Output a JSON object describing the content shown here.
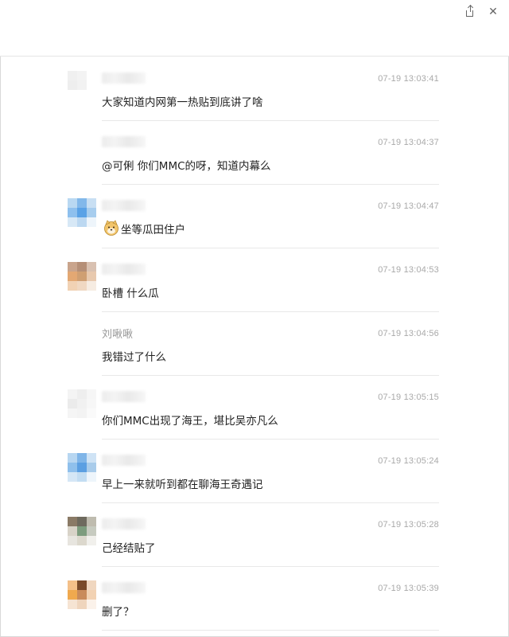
{
  "window": {
    "share_icon": "share-icon",
    "close_glyph": "✕"
  },
  "messages": [
    {
      "name": "",
      "time": "07-19 13:03:41",
      "text": "大家知道内网第一热贴到底讲了啥",
      "avatar": [
        "#f0f0f0",
        "#f3f3f3",
        "#ffffff",
        "#eeeeee",
        "#f2f2f2",
        "#ffffff",
        "#ffffff",
        "#ffffff",
        "#ffffff"
      ]
    },
    {
      "name": "",
      "time": "07-19 13:04:37",
      "text": "@可俐 你们MMC的呀，知道内幕么",
      "avatar": [
        "#ffffff",
        "#ffffff",
        "#ffffff",
        "#ffffff",
        "#ffffff",
        "#ffffff",
        "#ffffff",
        "#ffffff",
        "#ffffff"
      ]
    },
    {
      "name": "",
      "time": "07-19 13:04:47",
      "text": "坐等瓜田住户",
      "emoji": "doge-emoji",
      "avatar": [
        "#b9d8f2",
        "#82b8ea",
        "#c8dff3",
        "#8ec0ee",
        "#5aa2e6",
        "#a7cdee",
        "#d7e8f6",
        "#bcd8f1",
        "#eef5fb"
      ]
    },
    {
      "name": "",
      "time": "07-19 13:04:53",
      "text": "卧槽 什么瓜",
      "avatar": [
        "#c9a48c",
        "#b58f77",
        "#d9c1b1",
        "#e3a873",
        "#cf9f72",
        "#e8c9ae",
        "#f1d2b4",
        "#f0d8c2",
        "#f6ece2"
      ]
    },
    {
      "name": "刘啾啾",
      "time": "07-19 13:04:56",
      "text": "我错过了什么",
      "avatar": [
        "#ffffff",
        "#ffffff",
        "#ffffff",
        "#ffffff",
        "#ffffff",
        "#ffffff",
        "#ffffff",
        "#ffffff",
        "#ffffff"
      ]
    },
    {
      "name": "",
      "time": "07-19 13:05:15",
      "text": "你们MMC出现了海王，堪比吴亦凡么",
      "avatar": [
        "#f4f4f4",
        "#eeeeee",
        "#f6f6f6",
        "#ebebeb",
        "#f1f1f1",
        "#f7f7f7",
        "#f5f5f5",
        "#f3f3f3",
        "#fafafa"
      ]
    },
    {
      "name": "",
      "time": "07-19 13:05:24",
      "text": "早上一来就听到都在聊海王奇遇记",
      "avatar": [
        "#b7d6f1",
        "#7fb5e8",
        "#cfe3f5",
        "#8fc0ec",
        "#5b9fe2",
        "#a9cceb",
        "#d5e7f6",
        "#c3ddf2",
        "#eef5fb"
      ]
    },
    {
      "name": "",
      "time": "07-19 13:05:28",
      "text": "己经结贴了",
      "avatar": [
        "#8a7a66",
        "#6e6a5e",
        "#bfbcaf",
        "#d8d3c8",
        "#7d9c7e",
        "#c7cbc0",
        "#e7e5df",
        "#dcd8cd",
        "#f1f0ec"
      ]
    },
    {
      "name": "",
      "time": "07-19 13:05:39",
      "text": "删了？",
      "avatar": [
        "#f4c089",
        "#7a4a2a",
        "#f0d7c0",
        "#f0a94e",
        "#c98b5b",
        "#f2d2b3",
        "#f6e4d3",
        "#efd5bd",
        "#fbf2ea"
      ]
    }
  ]
}
